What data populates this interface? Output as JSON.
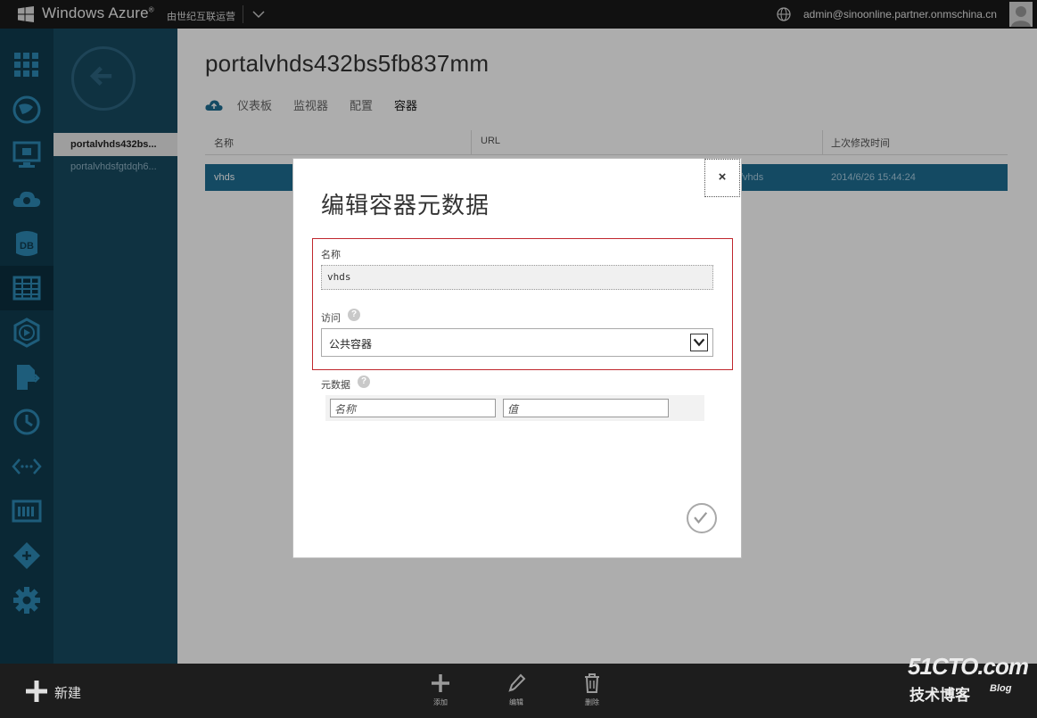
{
  "topbar": {
    "brand": "Windows Azure",
    "brand_mark": "®",
    "operator": "由世纪互联运营",
    "user": "admin@sinoonline.partner.onmschina.cn"
  },
  "rail": {
    "icons": [
      "all-items-icon",
      "web-sites-icon",
      "virtual-machines-icon",
      "cloud-services-icon",
      "sql-databases-icon",
      "storage-icon",
      "media-services-icon",
      "import-export-icon",
      "scheduler-icon",
      "networks-icon",
      "traffic-manager-icon",
      "service-bus-icon",
      "settings-icon"
    ],
    "db_label": "DB",
    "active": "storage-icon"
  },
  "subnav": {
    "items": [
      {
        "label": "portalvhds432bs...",
        "selected": true
      },
      {
        "label": "portalvhdsfgtdqh6...",
        "selected": false
      }
    ]
  },
  "main": {
    "title": "portalvhds432bs5fb837mm",
    "tabs": [
      "仪表板",
      "监视器",
      "配置",
      "容器"
    ],
    "active_tab": "容器",
    "columns": [
      "名称",
      "URL",
      "上次修改时间"
    ],
    "row": {
      "name": "vhds",
      "url": "/vhds",
      "modified": "2014/6/26 15:44:24"
    }
  },
  "dialog": {
    "title": "编辑容器元数据",
    "close_symbol": "×",
    "name_label": "名称",
    "name_value": "vhds",
    "access_label": "访问",
    "access_value": "公共容器",
    "metadata_label": "元数据",
    "help_symbol": "?",
    "meta_name_placeholder": "名称",
    "meta_value_placeholder": "值"
  },
  "bottombar": {
    "new_label": "新建",
    "commands": [
      "添加",
      "编辑",
      "删除"
    ]
  },
  "watermark": {
    "line1": "51CTO.com",
    "line2": "技术博客",
    "blog": "Blog"
  },
  "colors": {
    "rail": "#103c4f",
    "subnav": "#174a61",
    "selected_row": "#1e6d93",
    "highlight": "#c0272d"
  }
}
